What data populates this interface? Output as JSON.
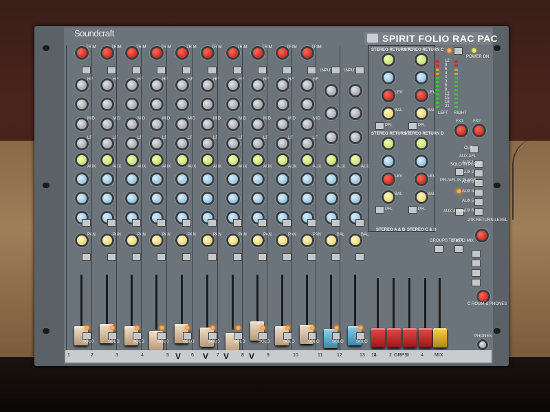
{
  "brand": "Soundcraft",
  "model": "SPIRIT FOLIO RAC PAC",
  "labels": {
    "trim": "TRIM",
    "eq_hf": "HF",
    "eq_mid": "MID",
    "eq_lf": "LF",
    "aux": "AUX",
    "pan": "PAN",
    "solo": "SOLO",
    "pfl": "PFL",
    "input": "INPUT",
    "lev": "LEV",
    "bal": "BAL",
    "stereo_return_a": "STEREO RETURN A",
    "stereo_return_b": "STEREO RETURN B",
    "stereo_return_c": "STEREO RETURN C",
    "stereo_return_d": "STEREO RETURN D",
    "stereo_a_b": "STEREO A & B",
    "stereo_c_d": "STEREO C & D",
    "power_on": "POWER ON",
    "fx1": "FX1",
    "fx2": "FX2",
    "cut": "CUT",
    "aux_afl": "AUX AFL",
    "solo_in_place": "SOLO IN PLACE",
    "pfl_afl": "PFL/AFL IN PLACE",
    "aux_pre": "AUX 4 PRE",
    "ste_return_level": "2TK RETURN LEVEL",
    "groups_to_mix": "GROUPS TO MIX",
    "ste_to_mix": "2TK TO MIX",
    "c_room_phones": "C ROOM & PHONES",
    "phones": "PHONES",
    "left": "LEFT",
    "right": "RIGHT",
    "grps": "GRPS",
    "mix": "MIX"
  },
  "aux_buttons": [
    "AUX 1",
    "AUX 2",
    "AUX 3",
    "AUX 4",
    "AUX 5",
    "AUX 6"
  ],
  "channel_numbers": [
    "1",
    "2",
    "3",
    "4",
    "5",
    "6",
    "7",
    "8",
    "9",
    "10",
    "11",
    "12",
    "13",
    "14"
  ],
  "group_numbers": [
    "1",
    "2",
    "3",
    "4"
  ],
  "bottom_marks": [
    "V",
    "V",
    "V",
    "V"
  ],
  "meter_scale": [
    "12",
    "9",
    "6",
    "3",
    "0",
    "3",
    "6",
    "9",
    "12",
    "15",
    "18",
    "21"
  ],
  "colors": {
    "panel": "#6b747a",
    "trim_knob": "#d02018",
    "aux_knob_green": "#c8e078",
    "aux_knob_blue": "#9acce8",
    "pan_knob": "#f0d878",
    "mono_fader": "#d8c0a0",
    "stereo_fader": "#5aaed0",
    "group_fader": "#c82828",
    "mix_fader": "#e8b830",
    "led": "#ff8a20"
  }
}
